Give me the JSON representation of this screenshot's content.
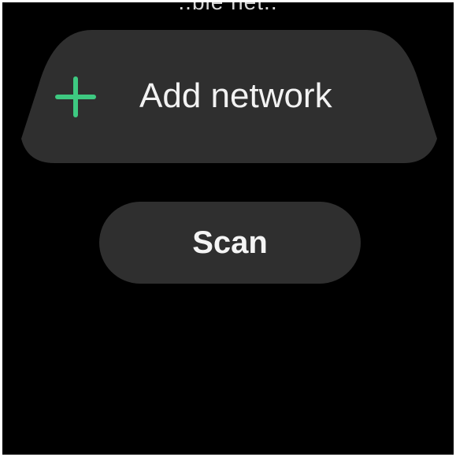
{
  "header": {
    "partial_text": "..ble net.."
  },
  "add_network": {
    "label": "Add network",
    "icon": "plus-icon",
    "icon_color": "#3ec981"
  },
  "scan": {
    "label": "Scan"
  },
  "colors": {
    "background": "#000000",
    "chip": "#2f2f2f",
    "text": "#f2f2f2",
    "accent": "#3ec981"
  }
}
